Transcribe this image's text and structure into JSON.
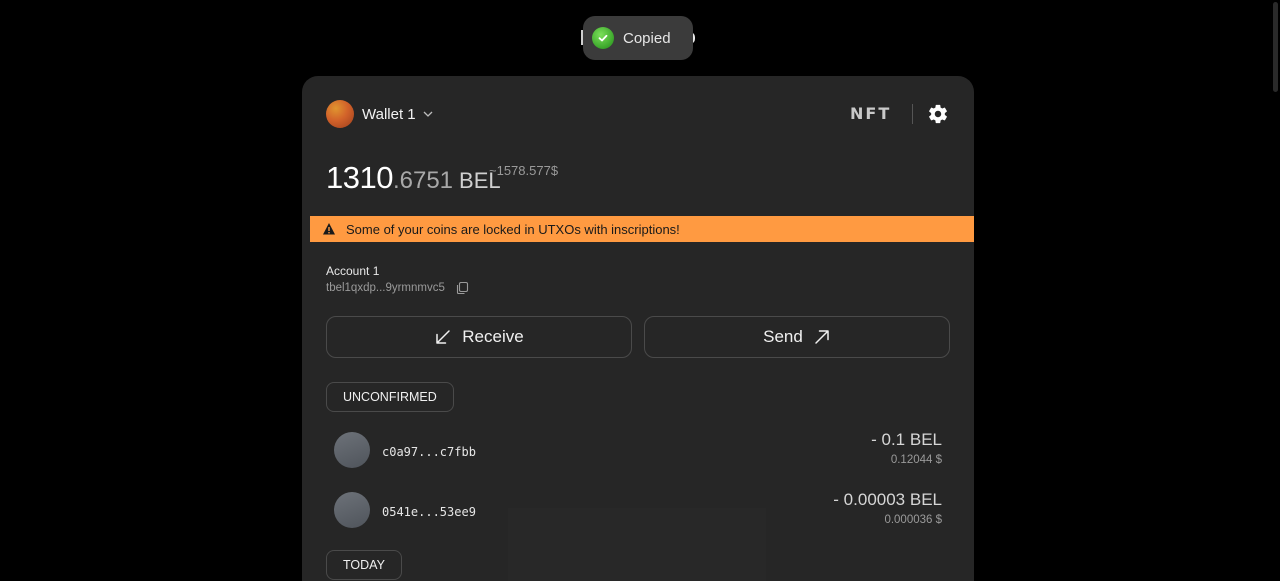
{
  "toast": {
    "message": "Copied",
    "icon": "check-circle-icon"
  },
  "header": {
    "wallet_name": "Wallet 1",
    "nft_label": "NFT",
    "settings_icon": "gear-icon"
  },
  "balance": {
    "integer": "1310",
    "fraction": ".6751",
    "unit": "BEL",
    "usd_estimate": "~1578.577$"
  },
  "warning": {
    "text": "Some of your coins are locked in UTXOs with inscriptions!",
    "icon": "warning-triangle-icon"
  },
  "account": {
    "name": "Account 1",
    "address_short": "tbel1qxdp...9yrmnmvc5"
  },
  "actions": {
    "receive_label": "Receive",
    "send_label": "Send"
  },
  "sections": {
    "unconfirmed_label": "UNCONFIRMED",
    "today_label": "TODAY"
  },
  "transactions": [
    {
      "id": "c0a97...c7fbb",
      "amount": "- 0.1 BEL",
      "usd": "0.12044 $"
    },
    {
      "id": "0541e...53ee9",
      "amount": "- 0.00003 BEL",
      "usd": "0.000036 $"
    }
  ],
  "colors": {
    "background": "#000000",
    "card": "#262626",
    "warning": "#ff9a41",
    "toast": "#3b3b3b",
    "success": "#3aa52a"
  }
}
